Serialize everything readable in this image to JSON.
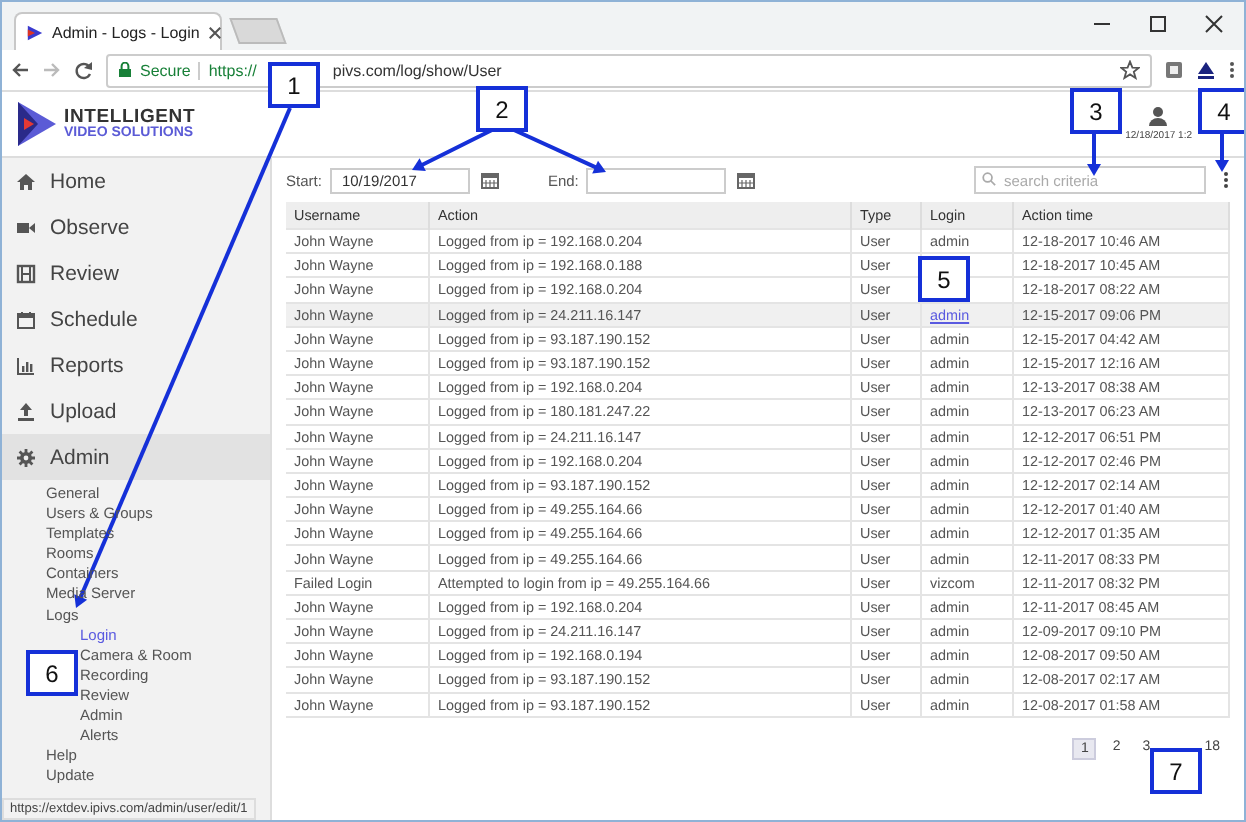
{
  "browser": {
    "tab_title": "Admin - Logs - Login",
    "secure_label": "Secure",
    "url_start": "https://",
    "url_end": "pivs.com/log/show/User",
    "status_url": "https://extdev.ipivs.com/admin/user/edit/1"
  },
  "header": {
    "logo_line1": "INTELLIGENT",
    "logo_line2": "VIDEO SOLUTIONS",
    "timestamp": "12/18/2017 1:2"
  },
  "sidebar": {
    "items": [
      {
        "label": "Home",
        "selected": false
      },
      {
        "label": "Observe",
        "selected": false
      },
      {
        "label": "Review",
        "selected": false
      },
      {
        "label": "Schedule",
        "selected": false
      },
      {
        "label": "Reports",
        "selected": false
      },
      {
        "label": "Upload",
        "selected": false
      },
      {
        "label": "Admin",
        "selected": true
      }
    ],
    "submenu": [
      {
        "label": "General",
        "selected": false
      },
      {
        "label": "Users & Groups",
        "selected": false
      },
      {
        "label": "Templates",
        "selected": false
      },
      {
        "label": "Rooms",
        "selected": false
      },
      {
        "label": "Containers",
        "selected": false
      },
      {
        "label": "Media Server",
        "selected": false
      },
      {
        "label": "Logs",
        "selected": false,
        "children": [
          {
            "label": "Login",
            "selected": true
          },
          {
            "label": "Camera & Room",
            "selected": false
          },
          {
            "label": "Recording",
            "selected": false
          },
          {
            "label": "Review",
            "selected": false
          },
          {
            "label": "Admin",
            "selected": false
          },
          {
            "label": "Alerts",
            "selected": false
          }
        ]
      },
      {
        "label": "Help",
        "selected": false
      },
      {
        "label": "Update",
        "selected": false
      }
    ]
  },
  "filters": {
    "start_label": "Start:",
    "start_value": "10/19/2017",
    "end_label": "End:",
    "search": {
      "placeholder": "search criteria"
    }
  },
  "table": {
    "columns": [
      "Username",
      "Action",
      "Type",
      "Login",
      "Action time"
    ],
    "rows": [
      {
        "username": "John Wayne",
        "action": "Logged from ip = 192.168.0.204",
        "type": "User",
        "login": "admin",
        "time": "12-18-2017 10:46 AM",
        "hovered": false
      },
      {
        "username": "John Wayne",
        "action": "Logged from ip = 192.168.0.188",
        "type": "User",
        "time": "12-18-2017 10:45 AM",
        "hovered": false
      },
      {
        "username": "John Wayne",
        "action": "Logged from ip = 192.168.0.204",
        "type": "User",
        "time": "12-18-2017 08:22 AM",
        "hovered": false
      },
      {
        "username": "John Wayne",
        "action": "Logged from ip = 24.211.16.147",
        "type": "User",
        "login": "admin",
        "time": "12-15-2017 09:06 PM",
        "hovered": true
      },
      {
        "username": "John Wayne",
        "action": "Logged from ip = 93.187.190.152",
        "type": "User",
        "login": "admin",
        "time": "12-15-2017 04:42 AM",
        "hovered": false
      },
      {
        "username": "John Wayne",
        "action": "Logged from ip = 93.187.190.152",
        "type": "User",
        "login": "admin",
        "time": "12-15-2017 12:16 AM",
        "hovered": false
      },
      {
        "username": "John Wayne",
        "action": "Logged from ip = 192.168.0.204",
        "type": "User",
        "login": "admin",
        "time": "12-13-2017 08:38 AM",
        "hovered": false
      },
      {
        "username": "John Wayne",
        "action": "Logged from ip = 180.181.247.22",
        "type": "User",
        "login": "admin",
        "time": "12-13-2017 06:23 AM",
        "hovered": false
      },
      {
        "username": "John Wayne",
        "action": "Logged from ip = 24.211.16.147",
        "type": "User",
        "login": "admin",
        "time": "12-12-2017 06:51 PM",
        "hovered": false
      },
      {
        "username": "John Wayne",
        "action": "Logged from ip = 192.168.0.204",
        "type": "User",
        "login": "admin",
        "time": "12-12-2017 02:46 PM",
        "hovered": false
      },
      {
        "username": "John Wayne",
        "action": "Logged from ip = 93.187.190.152",
        "type": "User",
        "login": "admin",
        "time": "12-12-2017 02:14 AM",
        "hovered": false
      },
      {
        "username": "John Wayne",
        "action": "Logged from ip = 49.255.164.66",
        "type": "User",
        "login": "admin",
        "time": "12-12-2017 01:40 AM",
        "hovered": false
      },
      {
        "username": "John Wayne",
        "action": "Logged from ip = 49.255.164.66",
        "type": "User",
        "login": "admin",
        "time": "12-12-2017 01:35 AM",
        "hovered": false
      },
      {
        "username": "John Wayne",
        "action": "Logged from ip = 49.255.164.66",
        "type": "User",
        "login": "admin",
        "time": "12-11-2017 08:33 PM",
        "hovered": false
      },
      {
        "username": "Failed Login",
        "action": "Attempted to login from ip = 49.255.164.66",
        "type": "User",
        "login": "vizcom",
        "time": "12-11-2017 08:32 PM",
        "hovered": false
      },
      {
        "username": "John Wayne",
        "action": "Logged from ip = 192.168.0.204",
        "type": "User",
        "login": "admin",
        "time": "12-11-2017 08:45 AM",
        "hovered": false
      },
      {
        "username": "John Wayne",
        "action": "Logged from ip = 24.211.16.147",
        "type": "User",
        "login": "admin",
        "time": "12-09-2017 09:10 PM",
        "hovered": false
      },
      {
        "username": "John Wayne",
        "action": "Logged from ip = 192.168.0.194",
        "type": "User",
        "login": "admin",
        "time": "12-08-2017 09:50 AM",
        "hovered": false
      },
      {
        "username": "John Wayne",
        "action": "Logged from ip = 93.187.190.152",
        "type": "User",
        "login": "admin",
        "time": "12-08-2017 02:17 AM",
        "hovered": false
      },
      {
        "username": "John Wayne",
        "action": "Logged from ip = 93.187.190.152",
        "type": "User",
        "login": "admin",
        "time": "12-08-2017 01:58 AM",
        "hovered": false
      }
    ]
  },
  "pagination": [
    {
      "label": "1",
      "selected": true
    },
    {
      "label": "2",
      "selected": false
    },
    {
      "label": "3",
      "selected": false
    },
    {
      "label": "18",
      "selected": false
    }
  ],
  "callouts": [
    {
      "label": "1"
    },
    {
      "label": "2"
    },
    {
      "label": "3"
    },
    {
      "label": "4"
    },
    {
      "label": "5"
    },
    {
      "label": "6"
    },
    {
      "label": "7"
    }
  ]
}
